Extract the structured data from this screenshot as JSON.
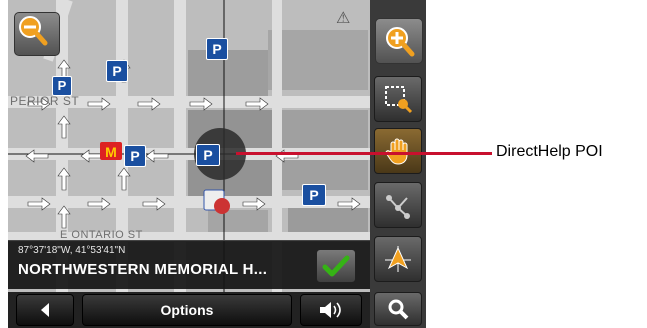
{
  "map": {
    "streets": {
      "superior": "PERIOR ST",
      "ontario": "E ONTARIO ST"
    },
    "warning_sign": "⚠",
    "parking_letter": "P"
  },
  "info": {
    "coordinates": "87°37'18\"W, 41°53'41\"N",
    "poi_name": "NORTHWESTERN MEMORIAL H..."
  },
  "bottom_bar": {
    "options_label": "Options"
  },
  "toolbar": {
    "items": [
      "select-area",
      "pan",
      "route",
      "position",
      "search"
    ]
  },
  "callout": {
    "label": "DirectHelp POI"
  },
  "colors": {
    "callout": "#c8102e",
    "zoom": "#f0a020",
    "check": "#35b315"
  }
}
